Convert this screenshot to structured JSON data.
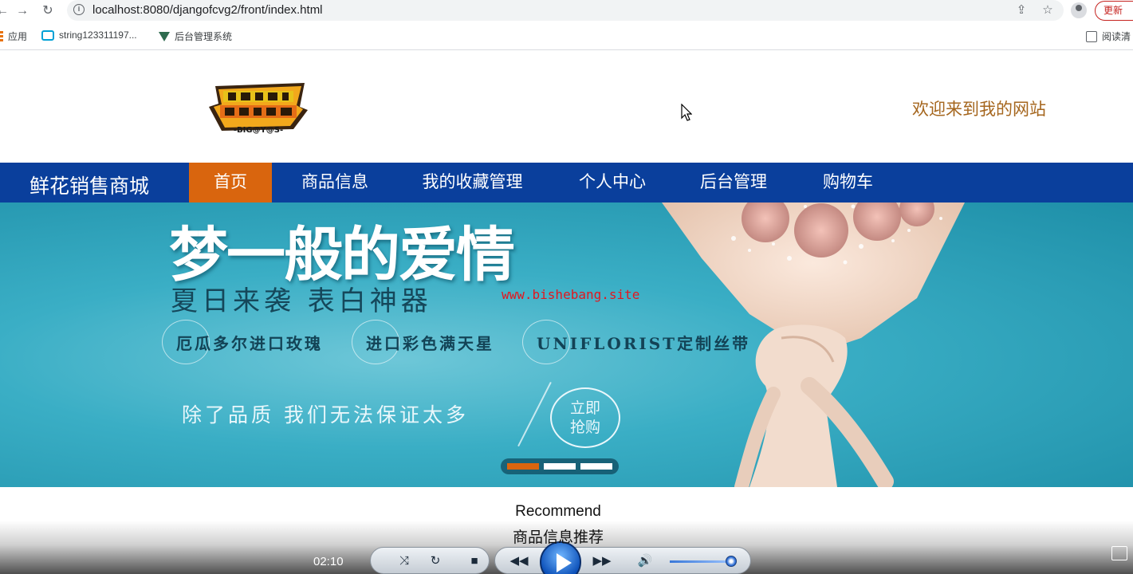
{
  "browser": {
    "url": "localhost:8080/djangofcvg2/front/index.html",
    "update_label": "更新",
    "bookmarks": [
      {
        "label": "应用",
        "icon": "apps-grid-icon"
      },
      {
        "label": "string123311197...",
        "icon": "bilibili-icon"
      },
      {
        "label": "后台管理系统",
        "icon": "vue-logo-icon"
      }
    ],
    "reading_list_label": "阅读清"
  },
  "header": {
    "logo_alt": "logo",
    "logo_text": "-BIG@Y@S-",
    "welcome": "欢迎来到我的网站"
  },
  "nav": {
    "brand": "鲜花销售商城",
    "items": [
      {
        "label": "首页",
        "active": true
      },
      {
        "label": "商品信息",
        "active": false
      },
      {
        "label": "我的收藏管理",
        "active": false
      },
      {
        "label": "个人中心",
        "active": false
      },
      {
        "label": "后台管理",
        "active": false
      },
      {
        "label": "购物车",
        "active": false
      }
    ]
  },
  "banner": {
    "title": "梦一般的爱情",
    "subtitle": "夏日来袭 表白神器",
    "watermark": "www.bishebang.site",
    "features": [
      "厄瓜多尔进口玫瑰",
      "进口彩色满天星",
      "UNIFLORIST定制丝带"
    ],
    "slogan": "除了品质 我们无法保证太多",
    "buy_line1": "立即",
    "buy_line2": "抢购",
    "slide_count": 3,
    "active_slide": 1
  },
  "recommend": {
    "title_en": "Recommend",
    "title_cn": "商品信息推荐"
  },
  "player": {
    "time": "02:10",
    "volume_fraction": 0.9
  },
  "colors": {
    "nav_bg": "#0a3f9c",
    "accent": "#d9650e",
    "welcome": "#a5661e"
  }
}
